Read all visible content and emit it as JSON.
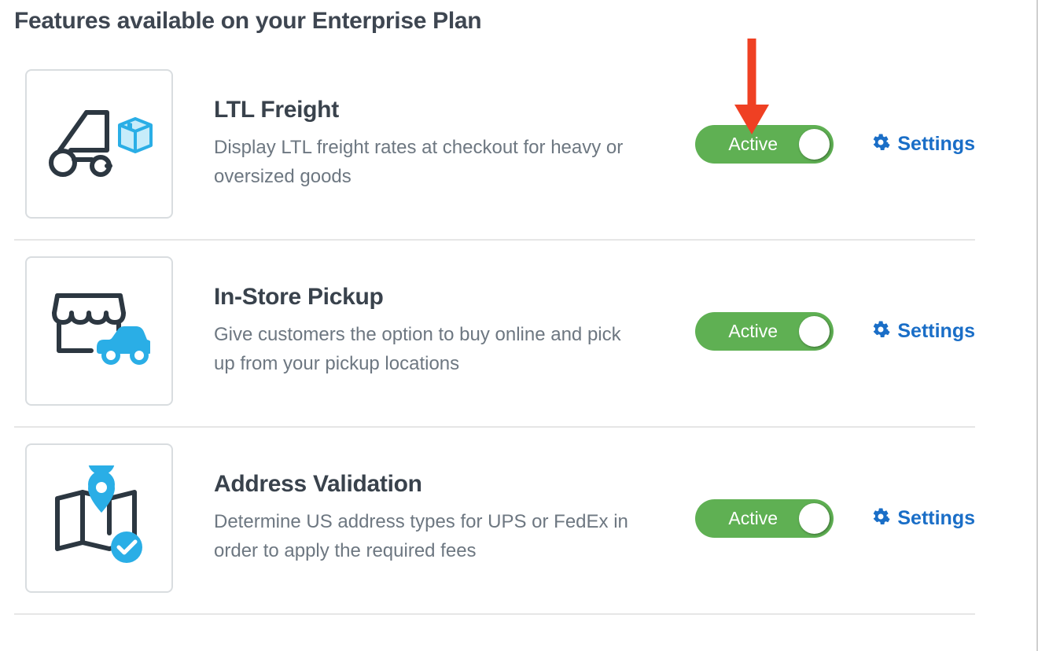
{
  "section_title": "Features available on your Enterprise Plan",
  "toggle_label": "Active",
  "settings_label": "Settings",
  "colors": {
    "accent_blue": "#1a6ec7",
    "icon_blue": "#2aaee6",
    "icon_dark": "#2c3741",
    "toggle_green": "#5fb053",
    "annotation_red": "#ef4023"
  },
  "features": [
    {
      "id": "ltl-freight",
      "title": "LTL Freight",
      "description": "Display LTL freight rates at checkout for heavy or oversized goods",
      "active": true,
      "icon": "forklift-box-icon"
    },
    {
      "id": "in-store-pickup",
      "title": "In-Store Pickup",
      "description": "Give customers the option to buy online and pick up from your pickup locations",
      "active": true,
      "icon": "store-car-icon"
    },
    {
      "id": "address-validation",
      "title": "Address Validation",
      "description": "Determine US address types for UPS or FedEx in order to apply the required fees",
      "active": true,
      "icon": "map-pin-check-icon"
    }
  ],
  "annotation": {
    "type": "arrow-down",
    "target": "ltl-freight-toggle"
  }
}
